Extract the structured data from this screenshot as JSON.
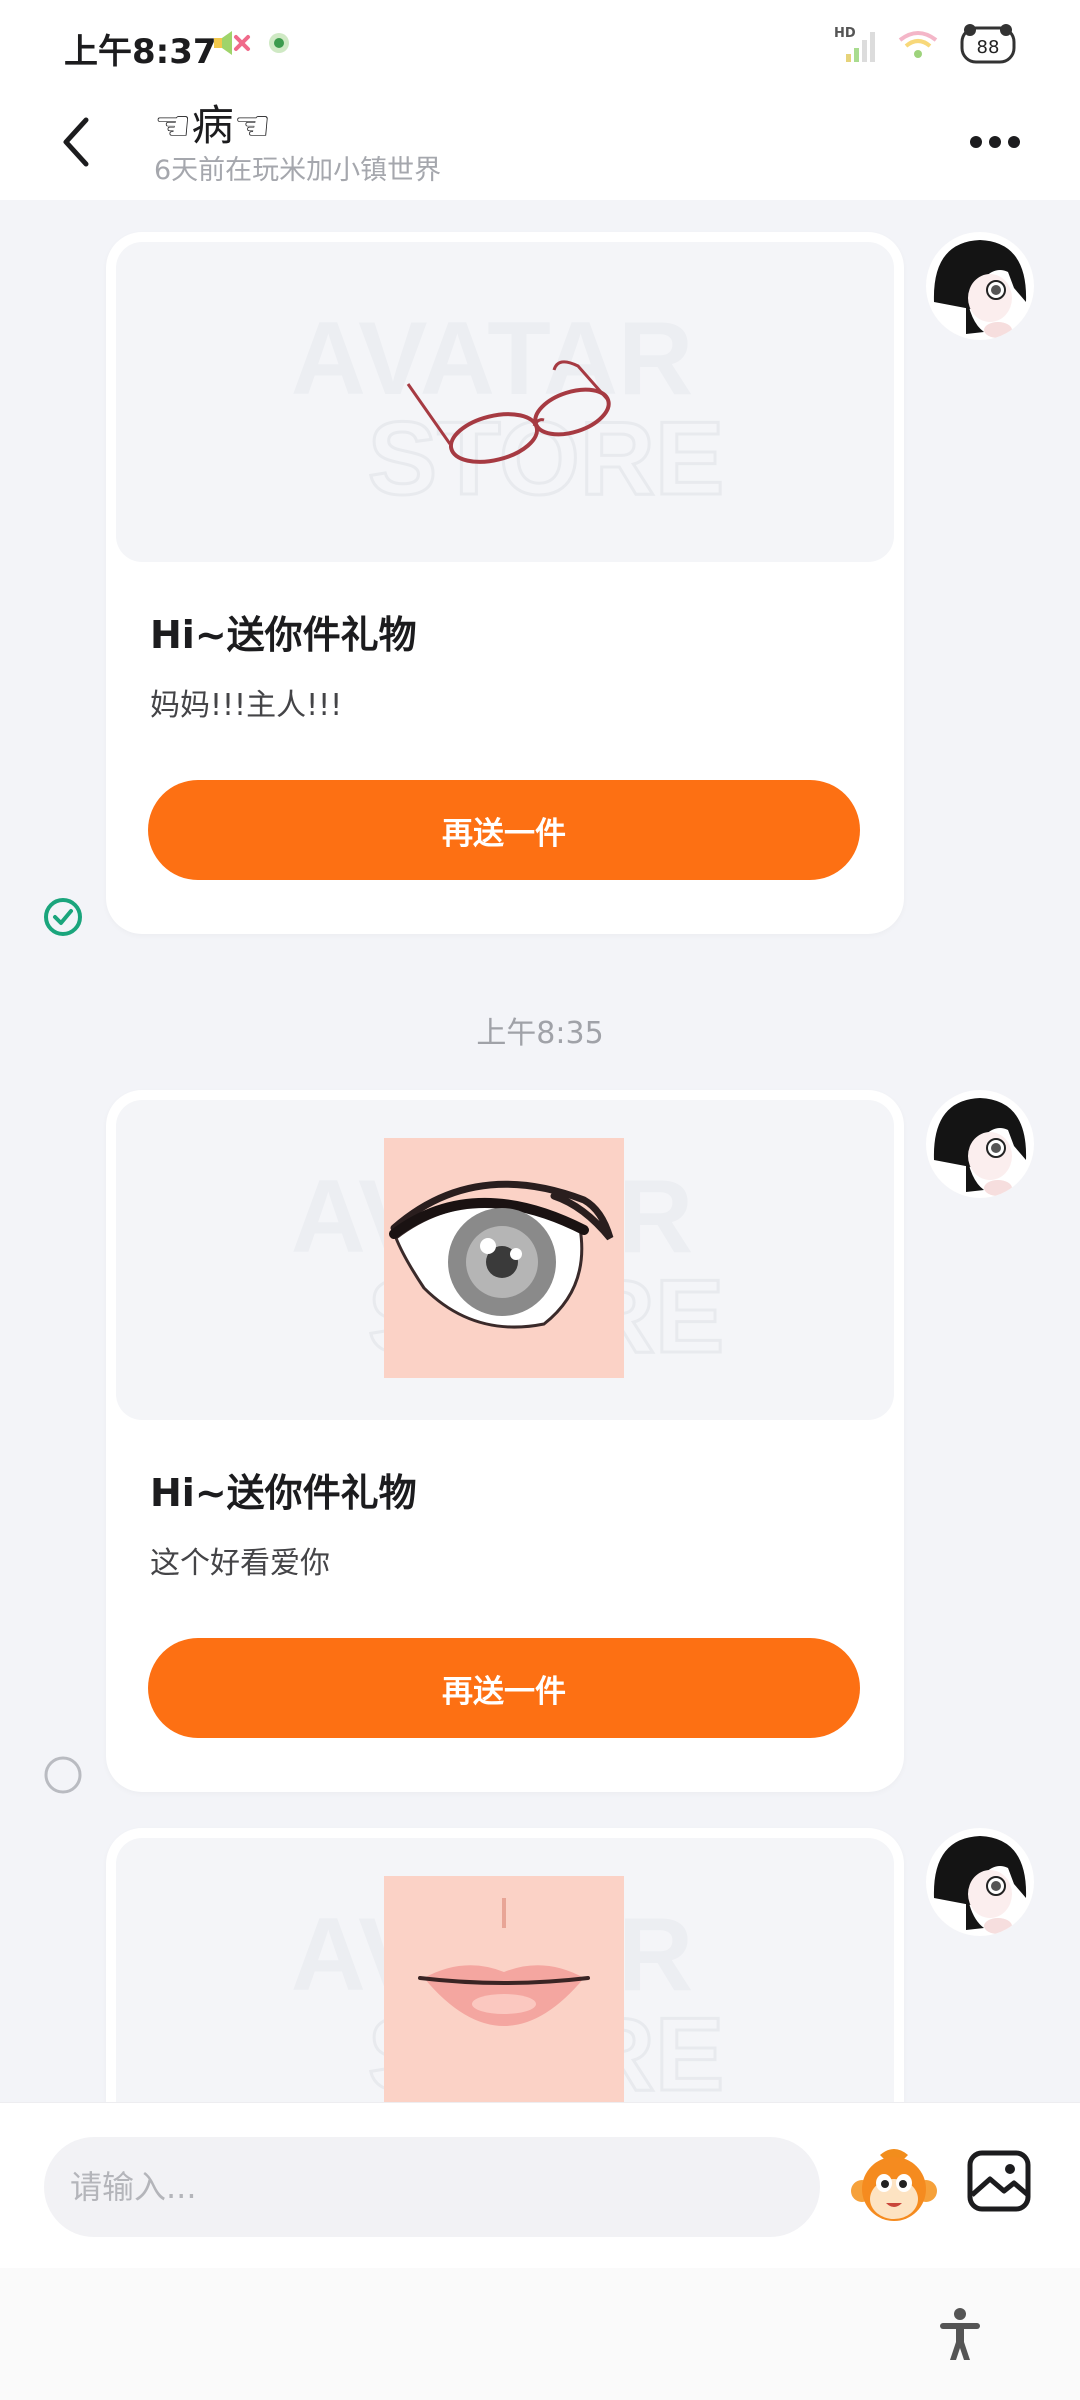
{
  "status_bar": {
    "time": "上午8:37",
    "network_label": "HD",
    "battery": "88"
  },
  "header": {
    "contact_name": "☜病☜",
    "subtitle": "6天前在玩米加小镇世界"
  },
  "messages": [
    {
      "title": "Hi~送你件礼物",
      "text": "妈妈!!!主人!!!",
      "button_label": "再送一件",
      "gift_icon": "glasses-icon",
      "status": "sent-check"
    },
    {
      "title": "Hi~送你件礼物",
      "text": "这个好看爱你",
      "button_label": "再送一件",
      "gift_icon": "eye-icon",
      "status": "pending-circle"
    },
    {
      "title": "",
      "text": "",
      "button_label": "",
      "gift_icon": "lips-icon",
      "status": ""
    }
  ],
  "timestamp": "上午8:35",
  "watermark": {
    "line1": "AVATAR",
    "line2": "STORE"
  },
  "composer": {
    "placeholder": "请输入..."
  },
  "colors": {
    "accent": "#fd7013",
    "check": "#1aa57c",
    "background": "#f3f4f8"
  }
}
